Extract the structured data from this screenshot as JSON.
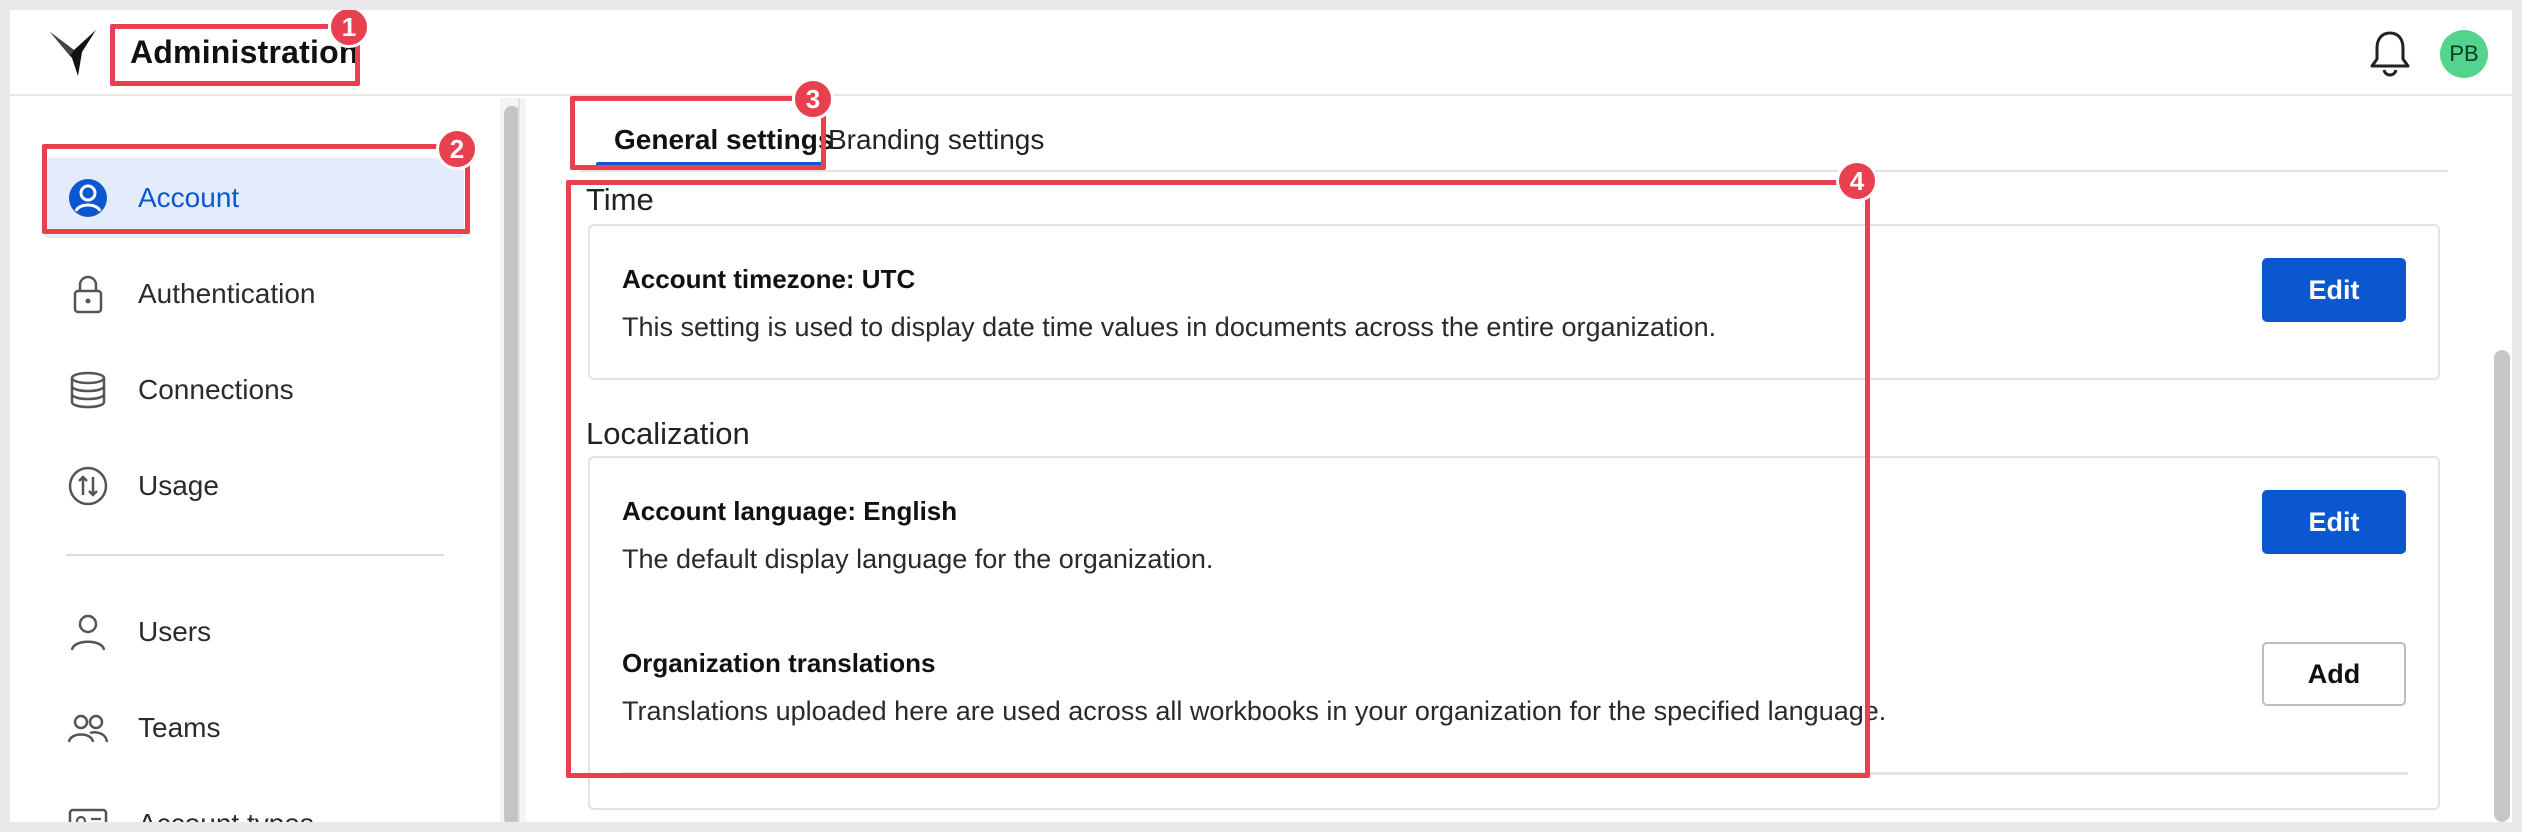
{
  "header": {
    "title": "Administration",
    "avatar_initials": "PB",
    "logo_icon": "bird-logo-icon",
    "notification_icon": "bell-icon"
  },
  "sidebar": {
    "items": [
      {
        "label": "Account",
        "icon": "account-circle-icon",
        "active": true
      },
      {
        "label": "Authentication",
        "icon": "lock-icon"
      },
      {
        "label": "Connections",
        "icon": "database-icon"
      },
      {
        "label": "Usage",
        "icon": "usage-icon"
      },
      {
        "label": "Users",
        "icon": "user-icon"
      },
      {
        "label": "Teams",
        "icon": "team-icon"
      },
      {
        "label": "Account types",
        "icon": "id-card-icon"
      }
    ]
  },
  "tabs": [
    {
      "label": "General settings",
      "active": true
    },
    {
      "label": "Branding settings"
    }
  ],
  "sections": {
    "time": {
      "title": "Time",
      "timezone_title": "Account timezone: UTC",
      "timezone_desc": "This setting is used to display date time values in documents across the entire organization.",
      "edit_label": "Edit"
    },
    "localization": {
      "title": "Localization",
      "language_title": "Account language: English",
      "language_desc": "The default display language for the organization.",
      "language_edit_label": "Edit",
      "translations_title": "Organization translations",
      "translations_desc": "Translations uploaded here are used across all workbooks in your organization for the specified language.",
      "add_label": "Add"
    }
  },
  "annotations": {
    "badges": [
      "1",
      "2",
      "3",
      "4"
    ],
    "color": "#e8404f"
  },
  "colors": {
    "accent": "#0b57d0",
    "active_bg": "#e4ebfb",
    "avatar_bg": "#52d48c"
  }
}
